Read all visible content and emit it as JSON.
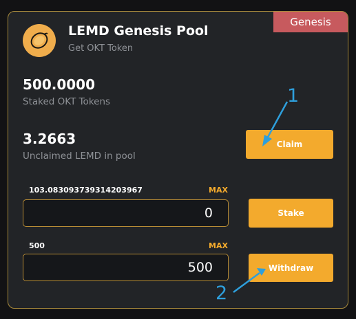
{
  "badge": "Genesis",
  "pool": {
    "title": "LEMD Genesis Pool",
    "subtitle": "Get OKT Token",
    "logo_icon": "lemon-token-icon"
  },
  "staked": {
    "value": "500.0000",
    "label": "Staked OKT Tokens"
  },
  "unclaimed": {
    "value": "3.2663",
    "label": "Unclaimed LEMD in pool"
  },
  "buttons": {
    "claim": "Claim",
    "stake": "Stake",
    "withdraw": "Withdraw"
  },
  "stake_form": {
    "balance": "103.083093739314203967",
    "max_label": "MAX",
    "value": "0"
  },
  "withdraw_form": {
    "balance": "500",
    "max_label": "MAX",
    "value": "500"
  },
  "annotations": {
    "one": "1",
    "two": "2"
  },
  "colors": {
    "accent": "#f3aa2d",
    "badge": "#c75a5e",
    "annotation": "#2e9fdc",
    "card_background": "#222427"
  }
}
